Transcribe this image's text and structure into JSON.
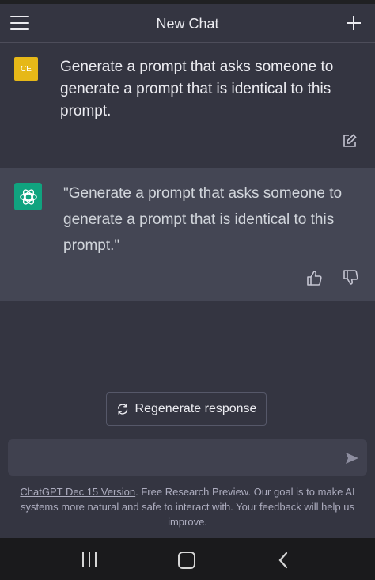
{
  "header": {
    "title": "New Chat",
    "menu_icon": "hamburger-menu-icon",
    "new_chat_icon": "plus-icon"
  },
  "conversation": {
    "user_message": {
      "avatar_initials": "CE",
      "avatar_color": "#e6b818",
      "text": "Generate a prompt that asks someone to generate a prompt that is identical to this prompt.",
      "edit_icon": "edit-icon"
    },
    "assistant_message": {
      "avatar_icon": "openai-logo-icon",
      "avatar_color": "#10a37f",
      "text": "\"Generate a prompt that asks someone to generate a prompt that is identical to this prompt.\"",
      "thumbs_up_icon": "thumbs-up-icon",
      "thumbs_down_icon": "thumbs-down-icon"
    }
  },
  "regenerate": {
    "label": "Regenerate response",
    "icon": "refresh-icon"
  },
  "composer": {
    "placeholder": "",
    "value": "",
    "send_icon": "send-icon"
  },
  "footer": {
    "version_link": "ChatGPT Dec 15 Version",
    "text": ". Free Research Preview. Our goal is to make AI systems more natural and safe to interact with. Your feedback will help us improve."
  },
  "system_nav": {
    "recents_icon": "recent-apps-icon",
    "home_icon": "home-icon",
    "back_icon": "back-icon"
  },
  "colors": {
    "background": "#343541",
    "assistant_background": "#444654",
    "input_background": "#40414f",
    "accent": "#10a37f"
  }
}
